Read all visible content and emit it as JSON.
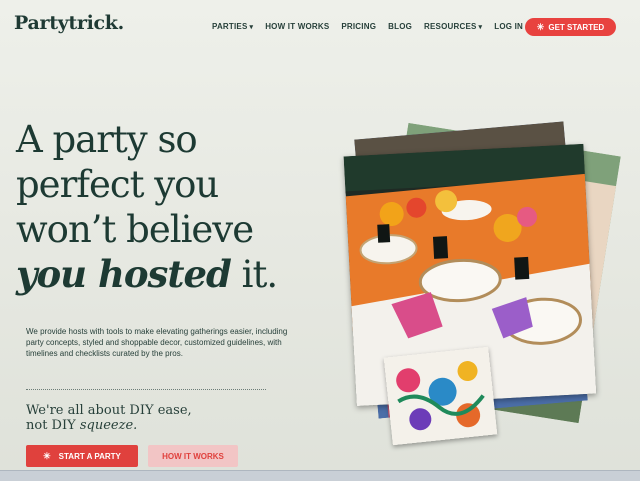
{
  "logo": "Partytrick.",
  "nav": {
    "items": [
      {
        "label": "PARTIES",
        "dropdown": true
      },
      {
        "label": "HOW IT WORKS",
        "dropdown": false
      },
      {
        "label": "PRICING",
        "dropdown": false
      },
      {
        "label": "BLOG",
        "dropdown": false
      },
      {
        "label": "RESOURCES",
        "dropdown": true
      },
      {
        "label": "LOG IN",
        "dropdown": false
      }
    ],
    "cta_label": "GET STARTED"
  },
  "hero": {
    "headline_line1": "A party so",
    "headline_line2": "perfect you",
    "headline_line3": "won’t believe",
    "headline_em": "you hosted",
    "headline_end": "it.",
    "description": "We provide hosts with tools to make elevating gatherings easier, including party concepts, styled and shoppable decor, customized guidelines, with timelines and checklists curated by the pros.",
    "tagline_a": "We're all about DIY ease,",
    "tagline_b": "not DIY",
    "tagline_em": "squeeze.",
    "primary_button": "START A PARTY",
    "secondary_button": "HOW IT WORKS"
  },
  "colors": {
    "accent": "#e8423f",
    "text": "#1d3a33",
    "secondary_button_bg": "#f2c5c5"
  },
  "icons": {
    "cta_icon": "sparkle-icon",
    "chevron": "chevron-down-icon"
  }
}
